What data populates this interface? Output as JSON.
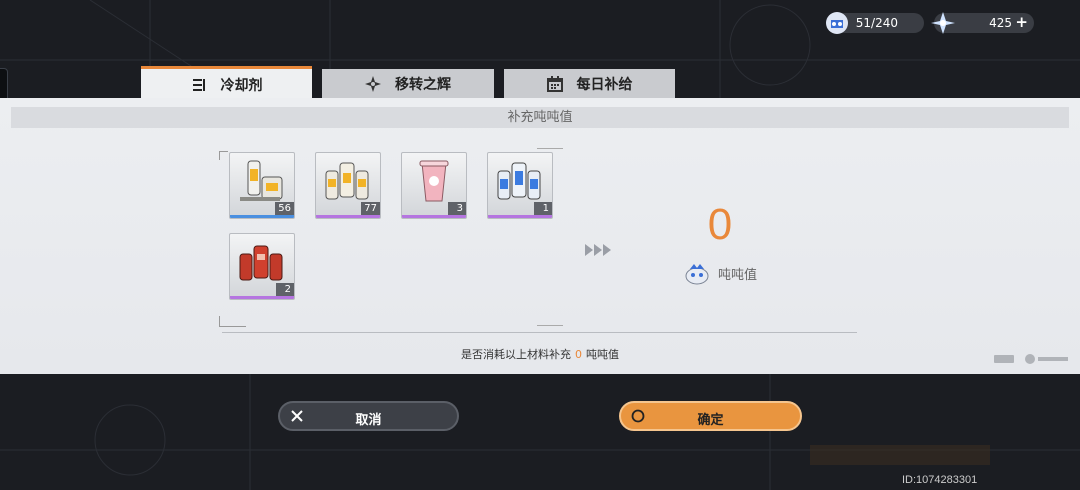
{
  "resources": {
    "stamina": "51/240",
    "crystal": "425"
  },
  "tabs": [
    {
      "label": "冷却剂",
      "active": true
    },
    {
      "label": "移转之辉",
      "active": false
    },
    {
      "label": "每日补给",
      "active": false
    }
  ],
  "panel": {
    "title": "补充吨吨值"
  },
  "items": [
    {
      "count": "56",
      "rarity_color": "#4a8fe0"
    },
    {
      "count": "77",
      "rarity_color": "#b575e0"
    },
    {
      "count": "3",
      "rarity_color": "#b575e0"
    },
    {
      "count": "1",
      "rarity_color": "#b575e0"
    },
    {
      "count": "2",
      "rarity_color": "#b575e0"
    }
  ],
  "result": {
    "value": "0",
    "label": "吨吨值"
  },
  "confirm": {
    "prefix": "是否消耗以上材料补充",
    "value": "0",
    "suffix": "吨吨值"
  },
  "buttons": {
    "cancel": "取消",
    "ok": "确定"
  },
  "footer": {
    "id": "ID:1074283301"
  },
  "colors": {
    "accent": "#e9883a"
  }
}
